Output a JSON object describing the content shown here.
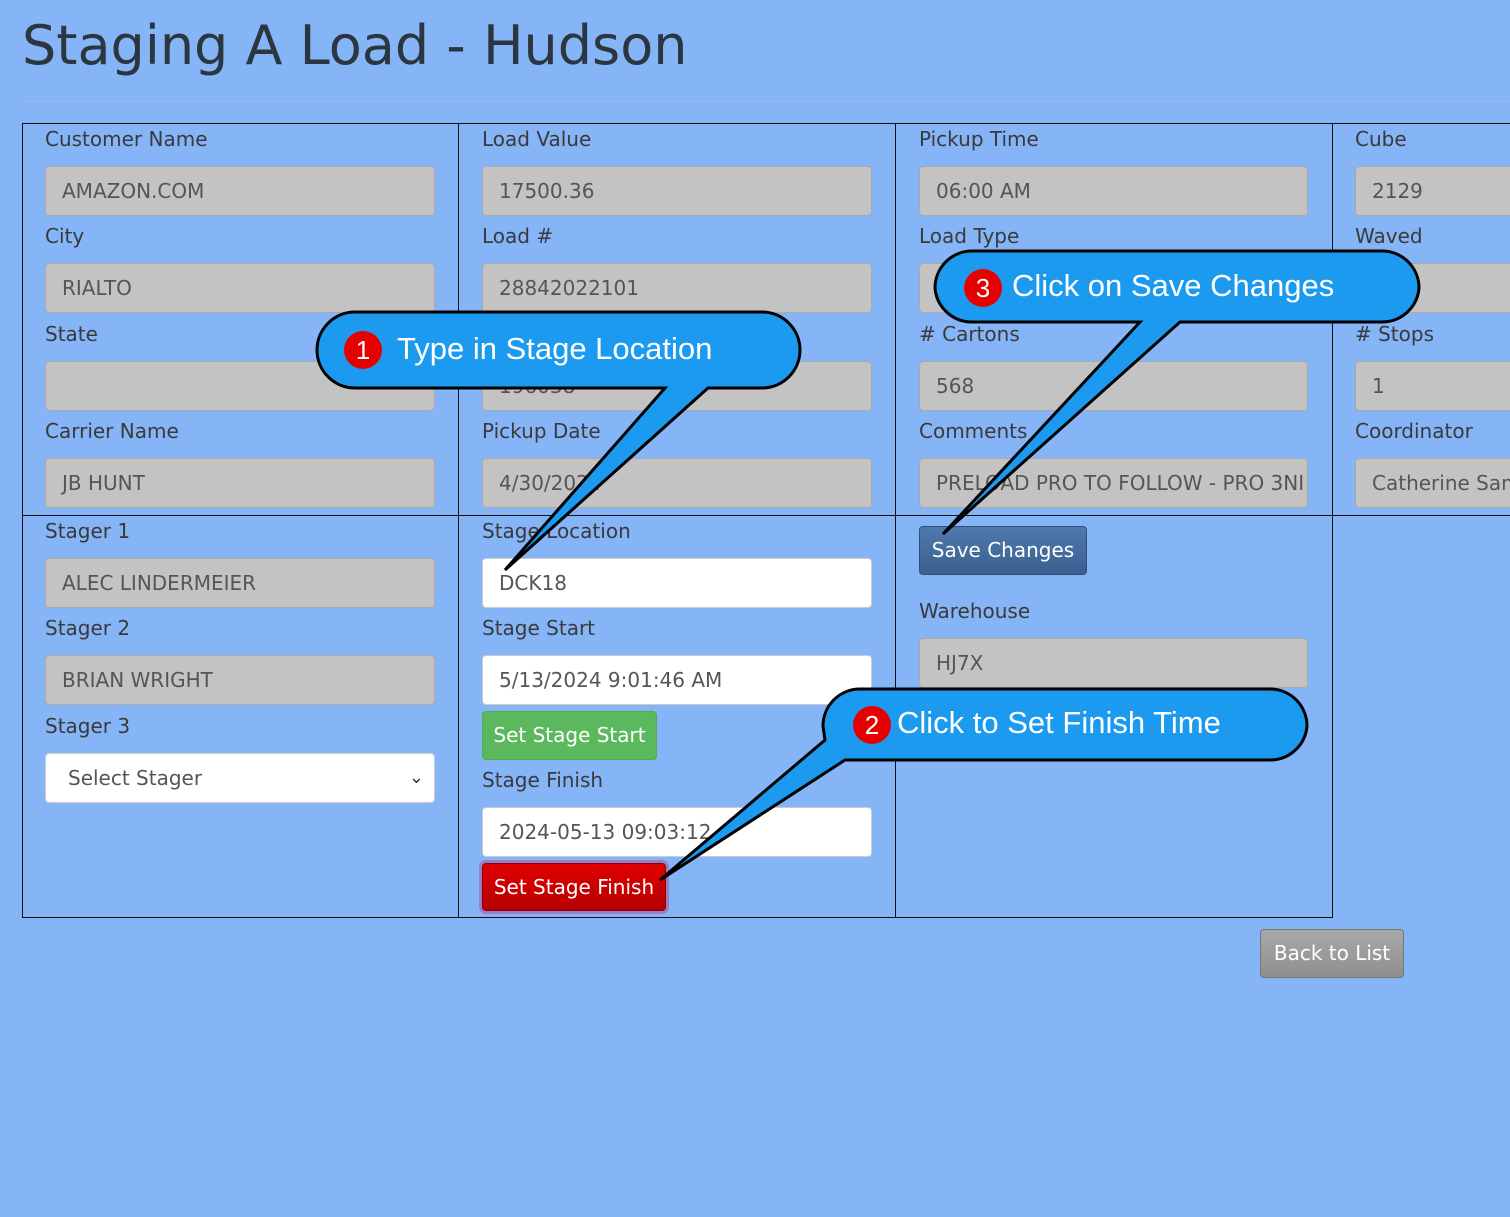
{
  "page": {
    "title": "Staging A Load - Hudson"
  },
  "fields": {
    "customer_name": {
      "label": "Customer Name",
      "value": "AMAZON.COM"
    },
    "city": {
      "label": "City",
      "value": "RIALTO"
    },
    "state": {
      "label": "State",
      "value": ""
    },
    "carrier_name": {
      "label": "Carrier Name",
      "value": "JB HUNT"
    },
    "load_value": {
      "label": "Load Value",
      "value": "17500.36"
    },
    "load_number": {
      "label": "Load #",
      "value": "28842022101"
    },
    "po_value": "196038",
    "pickup_date": {
      "label": "Pickup Date",
      "value": "4/30/2024"
    },
    "pickup_time": {
      "label": "Pickup Time",
      "value": "06:00 AM"
    },
    "load_type": {
      "label": "Load Type",
      "value": ""
    },
    "cartons": {
      "label": "# Cartons",
      "value": "568"
    },
    "comments": {
      "label": "Comments",
      "value": "PRELOAD PRO TO FOLLOW - PRO 3NI"
    },
    "cube": {
      "label": "Cube",
      "value": "2129"
    },
    "waved": {
      "label": "Waved",
      "value": ""
    },
    "stops": {
      "label": "# Stops",
      "value": "1"
    },
    "coordinator": {
      "label": "Coordinator",
      "value": "Catherine Sam"
    },
    "stager1": {
      "label": "Stager 1",
      "value": "ALEC LINDERMEIER"
    },
    "stager2": {
      "label": "Stager 2",
      "value": "BRIAN WRIGHT"
    },
    "stager3": {
      "label": "Stager 3",
      "value": "Select Stager"
    },
    "stage_location": {
      "label": "Stage Location",
      "value": "DCK18"
    },
    "stage_start": {
      "label": "Stage Start",
      "value": "5/13/2024 9:01:46 AM"
    },
    "stage_finish": {
      "label": "Stage Finish",
      "value": "2024-05-13 09:03:12"
    },
    "warehouse": {
      "label": "Warehouse",
      "value": "HJ7X"
    }
  },
  "buttons": {
    "set_stage_start": "Set Stage Start",
    "set_stage_finish": "Set Stage Finish",
    "save_changes": "Save Changes",
    "back_to_list": "Back to List"
  },
  "callouts": [
    {
      "number": "1",
      "text": "Type in Stage Location"
    },
    {
      "number": "2",
      "text": "Click to Set Finish Time"
    },
    {
      "number": "3",
      "text": "Click on Save Changes"
    }
  ],
  "colors": {
    "background": "#85b4f7",
    "callout_fill": "#1b9af0",
    "badge": "#e60000",
    "finish_button": "#d40000",
    "start_button": "#5cb85c",
    "save_button": "#3f6ba0"
  }
}
